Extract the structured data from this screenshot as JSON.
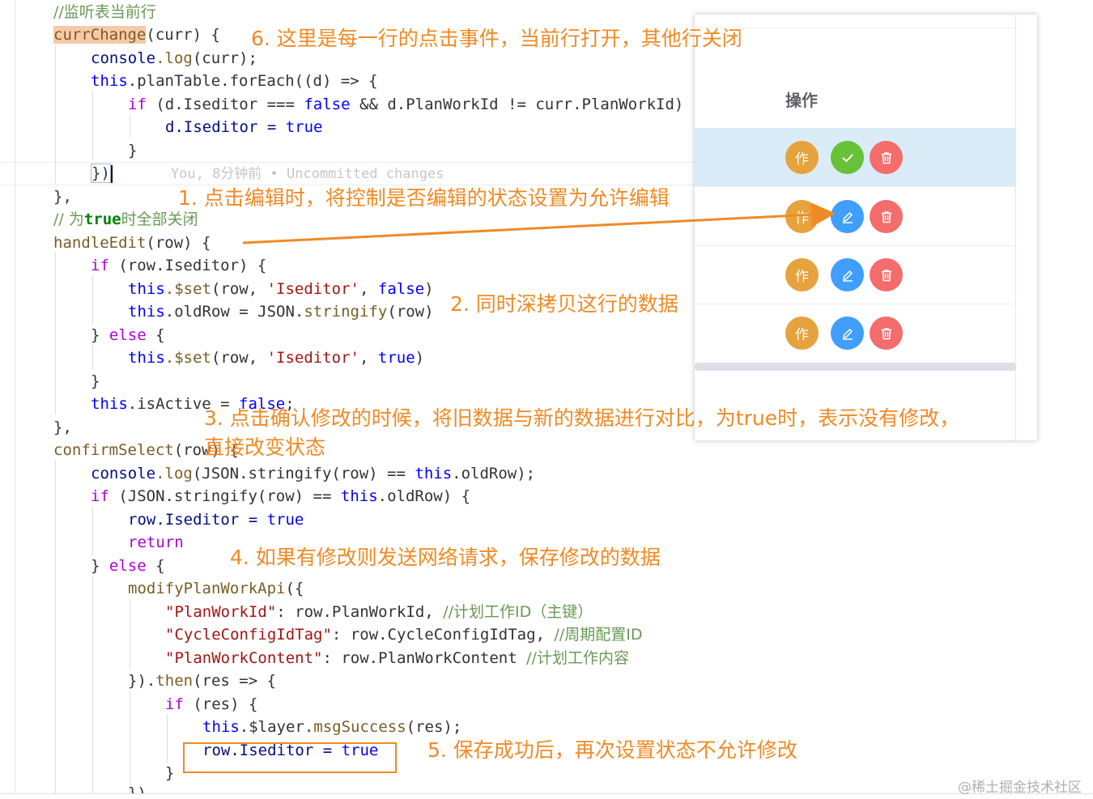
{
  "code": {
    "l1": {
      "comment": "//监听表当前行"
    },
    "l2": {
      "fn": "currChange",
      "rest": "(curr) {"
    },
    "l3": {
      "obj": "console",
      "method": ".log",
      "rest": "(curr);"
    },
    "l4": {
      "kw": "this",
      "rest": ".planTable.forEach(",
      "bracket": "(d) => {"
    },
    "l5": {
      "kw": "if",
      "rest": " (d.Iseditor === ",
      "bool": "false",
      "rest2": " && d.PlanWorkId != curr.PlanWorkId)"
    },
    "l6": {
      "rest": "d.Iseditor = ",
      "bool": "true"
    },
    "l7": {
      "rest": "}"
    },
    "l8": {
      "rest": "})",
      "blame": "You, 8分钟前 • Uncommitted changes"
    },
    "l9": {
      "rest": "},"
    },
    "l10": {
      "comment": "// 为",
      "bold": "true",
      "comment2": "时全部关闭"
    },
    "l11": {
      "fn": "handleEdit",
      "rest": "(row) {"
    },
    "l12": {
      "kw": "if",
      "rest": " (row.Iseditor) {"
    },
    "l13": {
      "kw": "this",
      "method": ".$set",
      "rest": "(row, ",
      "str": "'Iseditor'",
      "rest2": ", ",
      "bool": "false",
      "rest3": ")"
    },
    "l14": {
      "kw": "this",
      "rest": ".oldRow = JSON.",
      "method": "stringify",
      "rest2": "(row)"
    },
    "l15": {
      "rest": "} ",
      "kw": "else",
      "rest2": " {"
    },
    "l16": {
      "kw": "this",
      "method": ".$set",
      "rest": "(row, ",
      "str": "'Iseditor'",
      "rest2": ", ",
      "bool": "true",
      "rest3": ")"
    },
    "l17": {
      "rest": "}"
    },
    "l18": {
      "kw": "this",
      "rest": ".isActive = ",
      "bool": "false",
      "rest2": ";"
    },
    "l19": {
      "rest": "},"
    },
    "l20": {
      "fn": "confirmSelect",
      "rest": "(row) {"
    },
    "l21": {
      "obj": "console",
      "method": ".log",
      "rest": "(JSON.stringify(row) == ",
      "kw": "this",
      "rest2": ".oldRow);"
    },
    "l22": {
      "kw": "if",
      "rest": " (JSON.stringify(row) == ",
      "kw2": "this",
      "rest2": ".oldRow) {"
    },
    "l23": {
      "rest": "row.Iseditor = ",
      "bool": "true"
    },
    "l24": {
      "kw": "return"
    },
    "l25": {
      "rest": "} ",
      "kw": "else",
      "rest2": " {"
    },
    "l26": {
      "fn": "modifyPlanWorkApi",
      "rest": "({"
    },
    "l27": {
      "str": "\"PlanWorkId\"",
      "rest": ": row.PlanWorkId, ",
      "comment": "//计划工作ID（主键）"
    },
    "l28": {
      "str": "\"CycleConfigIdTag\"",
      "rest": ": row.CycleConfigIdTag, ",
      "comment": "//周期配置ID"
    },
    "l29": {
      "str": "\"PlanWorkContent\"",
      "rest": ": row.PlanWorkContent ",
      "comment": "//计划工作内容"
    },
    "l30": {
      "rest": "}).",
      "method": "then",
      "rest2": "(res => {"
    },
    "l31": {
      "kw": "if",
      "rest": " (res) {"
    },
    "l32": {
      "kw": "this",
      "rest": ".$layer.",
      "method": "msgSuccess",
      "rest2": "(res);"
    },
    "l33": {
      "rest": "row.Iseditor = ",
      "bool": "true"
    },
    "l34": {
      "rest": "}"
    },
    "l35": {
      "rest": "})"
    }
  },
  "annotations": {
    "a1": "1. 点击编辑时，将控制是否编辑的状态设置为允许编辑",
    "a2": "2. 同时深拷贝这行的数据",
    "a3": "3. 点击确认修改的时候，将旧数据与新的数据进行对比，为true时，表示没有修改，",
    "a3b": "直接改变状态",
    "a4": "4. 如果有修改则发送网络请求，保存修改的数据",
    "a5": "5. 保存成功后，再次设置状态不允许修改",
    "a6": "6. 这里是每一行的点击事件，当前行打开，其他行关闭"
  },
  "panel": {
    "header": "操作",
    "rows": [
      {
        "state": "active",
        "edit_label": "作",
        "action": "check-icon"
      },
      {
        "state": "normal",
        "edit_label": "作",
        "action": "pencil-icon"
      },
      {
        "state": "normal",
        "edit_label": "作",
        "action": "pencil-icon"
      },
      {
        "state": "normal",
        "edit_label": "作",
        "action": "pencil-icon"
      }
    ]
  },
  "watermark": "@稀土掘金技术社区",
  "colors": {
    "annotation": "#f08a24",
    "edit_btn": "#e6a23c",
    "confirm_btn": "#67c23a",
    "modify_btn": "#409eff",
    "delete_btn": "#f56c6c",
    "active_row": "#d9ecf7"
  }
}
